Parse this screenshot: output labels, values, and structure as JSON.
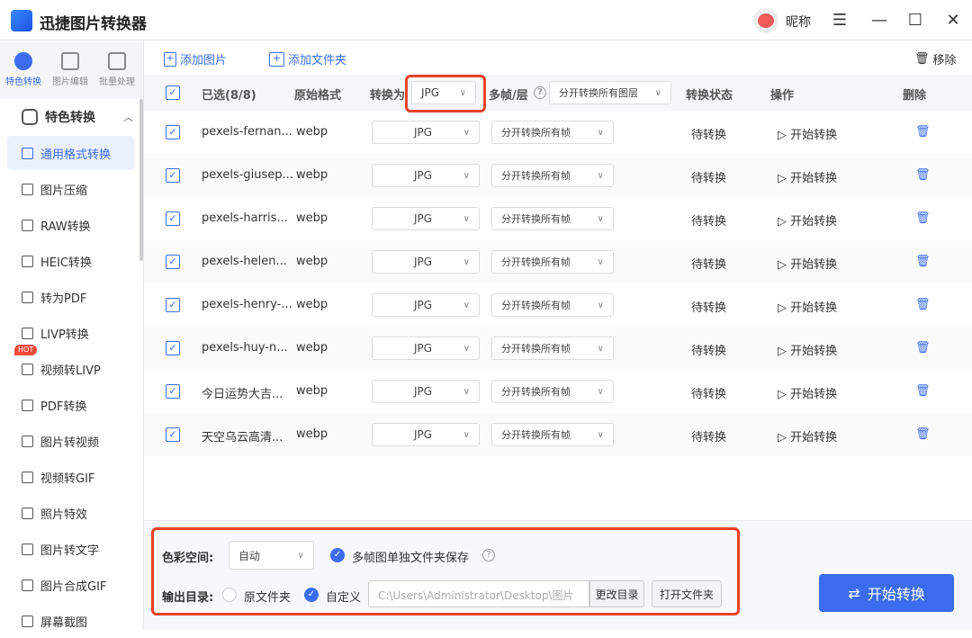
{
  "app": {
    "title": "迅捷图片转换器",
    "nickname": "昵称"
  },
  "sidebar": {
    "tabs": [
      {
        "label": "特色转换"
      },
      {
        "label": "图片编辑"
      },
      {
        "label": "批量处理"
      }
    ],
    "section": "特色转换",
    "items": [
      {
        "label": "通用格式转换",
        "active": true
      },
      {
        "label": "图片压缩"
      },
      {
        "label": "RAW转换"
      },
      {
        "label": "HEIC转换"
      },
      {
        "label": "转为PDF"
      },
      {
        "label": "LIVP转换"
      },
      {
        "label": "视频转LIVP",
        "badge": "HOT"
      },
      {
        "label": "PDF转换"
      },
      {
        "label": "图片转视频"
      },
      {
        "label": "视频转GIF"
      },
      {
        "label": "照片特效"
      },
      {
        "label": "图片转文字"
      },
      {
        "label": "图片合成GIF"
      },
      {
        "label": "屏幕截图"
      }
    ]
  },
  "toolbar": {
    "add_image": "添加图片",
    "add_folder": "添加文件夹",
    "remove": "移除"
  },
  "table": {
    "headers": {
      "selected": "已选(8/8)",
      "orig": "原始格式",
      "convert_to": "转换为",
      "convert_to_value": "JPG",
      "multiframe": "多帧/层",
      "multiframe_value": "分开转换所有图层",
      "status": "转换状态",
      "action": "操作",
      "delete": "删除"
    },
    "rows": [
      {
        "name": "pexels-fernan...",
        "format": "webp",
        "target": "JPG",
        "frames": "分开转换所有帧",
        "status": "待转换",
        "action": "开始转换"
      },
      {
        "name": "pexels-giusep...",
        "format": "webp",
        "target": "JPG",
        "frames": "分开转换所有帧",
        "status": "待转换",
        "action": "开始转换"
      },
      {
        "name": "pexels-harris...",
        "format": "webp",
        "target": "JPG",
        "frames": "分开转换所有帧",
        "status": "待转换",
        "action": "开始转换"
      },
      {
        "name": "pexels-helen...",
        "format": "webp",
        "target": "JPG",
        "frames": "分开转换所有帧",
        "status": "待转换",
        "action": "开始转换"
      },
      {
        "name": "pexels-henry-...",
        "format": "webp",
        "target": "JPG",
        "frames": "分开转换所有帧",
        "status": "待转换",
        "action": "开始转换"
      },
      {
        "name": "pexels-huy-n...",
        "format": "webp",
        "target": "JPG",
        "frames": "分开转换所有帧",
        "status": "待转换",
        "action": "开始转换"
      },
      {
        "name": "今日运势大吉...",
        "format": "webp",
        "target": "JPG",
        "frames": "分开转换所有帧",
        "status": "待转换",
        "action": "开始转换"
      },
      {
        "name": "天空乌云高清...",
        "format": "webp",
        "target": "JPG",
        "frames": "分开转换所有帧",
        "status": "待转换",
        "action": "开始转换"
      }
    ]
  },
  "bottom": {
    "color_space_label": "色彩空间:",
    "color_space_value": "自动",
    "multiframe_folder": "多帧图单独文件夹保存",
    "output_label": "输出目录:",
    "orig_folder": "原文件夹",
    "custom": "自定义",
    "path": "C:\\Users\\Administrator\\Desktop\\图片",
    "change_dir": "更改目录",
    "open_folder": "打开文件夹",
    "start": "开始转换"
  },
  "colors": {
    "accent": "#3b6cf0",
    "highlight": "#e8432a"
  }
}
